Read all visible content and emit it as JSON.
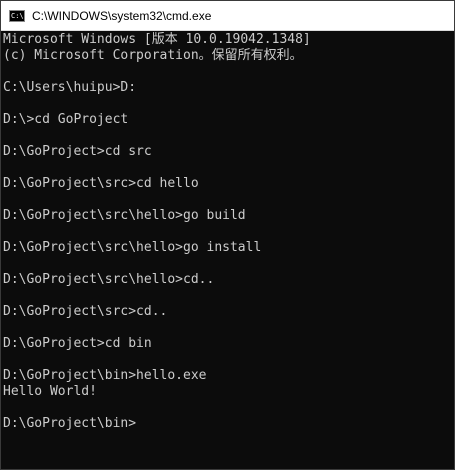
{
  "window": {
    "title": "C:\\WINDOWS\\system32\\cmd.exe",
    "icon": "cmd-icon",
    "icon_text": "C:\\"
  },
  "console": {
    "lines": [
      "Microsoft Windows [版本 10.0.19042.1348]",
      "(c) Microsoft Corporation。保留所有权利。",
      "",
      "C:\\Users\\huipu>D:",
      "",
      "D:\\>cd GoProject",
      "",
      "D:\\GoProject>cd src",
      "",
      "D:\\GoProject\\src>cd hello",
      "",
      "D:\\GoProject\\src\\hello>go build",
      "",
      "D:\\GoProject\\src\\hello>go install",
      "",
      "D:\\GoProject\\src\\hello>cd..",
      "",
      "D:\\GoProject\\src>cd..",
      "",
      "D:\\GoProject>cd bin",
      "",
      "D:\\GoProject\\bin>hello.exe",
      "Hello World!",
      "",
      "D:\\GoProject\\bin>"
    ]
  },
  "colors": {
    "background": "#0c0c0c",
    "foreground": "#cccccc",
    "titlebar": "#ffffff"
  }
}
